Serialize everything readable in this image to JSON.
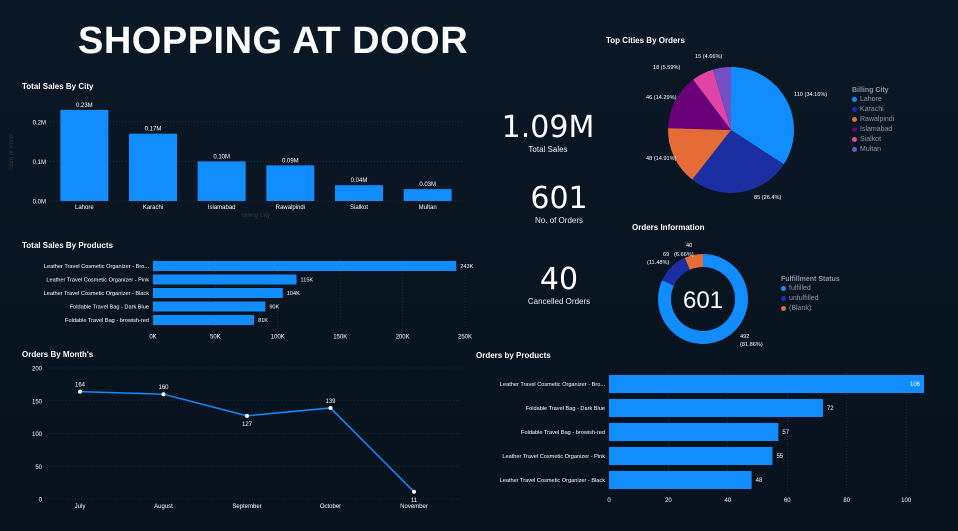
{
  "dashboard": {
    "title": "SHOPPING AT DOOR"
  },
  "kpis": {
    "total_sales": {
      "value": "1.09M",
      "label": "Total Sales"
    },
    "orders": {
      "value": "601",
      "label": "No. of Orders"
    },
    "cancelled": {
      "value": "40",
      "label": "Cancelled Orders"
    }
  },
  "colors": {
    "bar": "#118dff",
    "text": "#ffffff",
    "muted": "#6b7480",
    "grid": "#2a3a4a",
    "pie": [
      "#118dff",
      "#1b2fa3",
      "#e66c37",
      "#6b007b",
      "#e044a7",
      "#744ec2"
    ]
  },
  "chart_data": [
    {
      "id": "sales_by_city",
      "type": "bar",
      "title": "Total Sales By City",
      "xlabel": "Billing City",
      "ylabel": "Sum of Price",
      "categories": [
        "Lahore",
        "Karachi",
        "Islamabad",
        "Rawalpindi",
        "Sialkot",
        "Multan"
      ],
      "values": [
        0.23,
        0.17,
        0.1,
        0.09,
        0.04,
        0.03
      ],
      "data_labels": [
        "0.23M",
        "0.17M",
        "0.10M",
        "0.09M",
        "0.04M",
        "0.03M"
      ],
      "yticks": [
        "0.0M",
        "0.1M",
        "0.2M"
      ],
      "ylim": [
        0,
        0.25
      ]
    },
    {
      "id": "sales_by_products",
      "type": "bar",
      "orientation": "horizontal",
      "title": "Total Sales By Products",
      "categories": [
        "Leather Travel Cosmetic Organizer - Bro...",
        "Leather Travel Cosmetic Organizer - Pink",
        "Leather Travel Cosmetic Organizer - Black",
        "Foldable Travel Bag - Dark Blue",
        "Foldable Travel Bag - browish-red"
      ],
      "values": [
        243,
        115,
        104,
        90,
        81
      ],
      "data_labels": [
        "243K",
        "115K",
        "104K",
        "90K",
        "81K"
      ],
      "xticks": [
        "0K",
        "50K",
        "100K",
        "150K",
        "200K",
        "250K"
      ],
      "xlim": [
        0,
        250
      ]
    },
    {
      "id": "orders_by_month",
      "type": "line",
      "title": "Orders By Month's",
      "categories": [
        "July",
        "August",
        "September",
        "October",
        "November"
      ],
      "values": [
        164,
        160,
        127,
        139,
        11
      ],
      "yticks": [
        "0",
        "50",
        "100",
        "150",
        "200"
      ],
      "ylim": [
        0,
        200
      ]
    },
    {
      "id": "orders_by_products",
      "type": "bar",
      "orientation": "horizontal",
      "title": "Orders by Products",
      "categories": [
        "Leather Travel Cosmetic Organizer - Bro...",
        "Foldable Travel Bag - Dark Blue",
        "Foldable Travel Bag - browish-red",
        "Leather Travel Cosmetic Organizer - Pink",
        "Leather Travel Cosmetic Organizer - Black"
      ],
      "values": [
        106,
        72,
        57,
        55,
        48
      ],
      "xticks": [
        "0",
        "20",
        "40",
        "60",
        "80",
        "100"
      ],
      "xlim": [
        0,
        106
      ]
    },
    {
      "id": "top_cities",
      "type": "pie",
      "title": "Top Cities By Orders",
      "legend_title": "Billing City",
      "categories": [
        "Lahore",
        "Karachi",
        "Rawalpindi",
        "Islamabad",
        "Sialkot",
        "Multan"
      ],
      "values": [
        110,
        85,
        48,
        46,
        18,
        15
      ],
      "data_labels": [
        "110 (34.16%)",
        "85 (26.4%)",
        "48 (14.91%)",
        "46 (14.29%)",
        "18 (5.59%)",
        "15 (4.66%)"
      ],
      "legend": "right"
    },
    {
      "id": "orders_information",
      "type": "pie",
      "donut": true,
      "title": "Orders Information",
      "center_label": "601",
      "legend_title": "Fulfillment Status",
      "categories": [
        "fulfilled",
        "unfulfilled",
        "(Blank)"
      ],
      "values": [
        492,
        69,
        40
      ],
      "data_labels": [
        "492 (81.86%)",
        "69 (11.48%)",
        "40 (6.66%)"
      ],
      "legend": "right"
    }
  ]
}
